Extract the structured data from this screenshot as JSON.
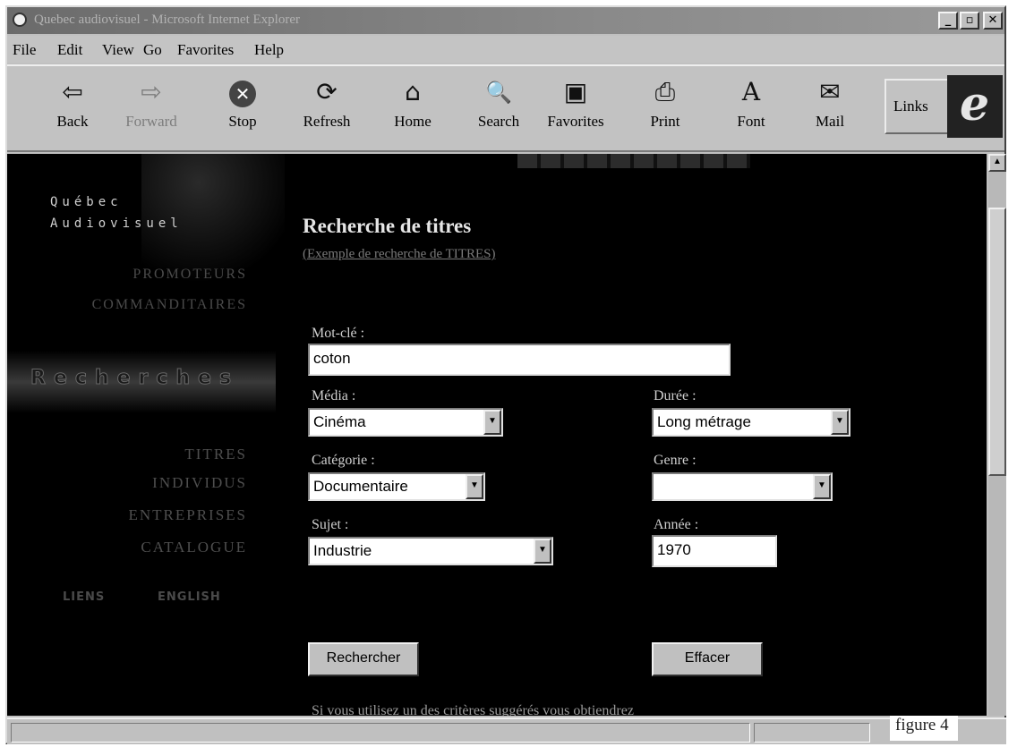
{
  "window": {
    "title": "Quebec audiovisuel - Microsoft Internet Explorer",
    "controls": {
      "minimize": "_",
      "maximize": "▫",
      "close": "✕"
    }
  },
  "menu": [
    "File",
    "Edit",
    "View",
    "Go",
    "Favorites",
    "Help"
  ],
  "toolbar": {
    "buttons": [
      {
        "label": "Back",
        "icon": "back-arrow-icon",
        "glyph": "⇦",
        "enabled": true
      },
      {
        "label": "Forward",
        "icon": "forward-arrow-icon",
        "glyph": "⇨",
        "enabled": false
      },
      {
        "label": "Stop",
        "icon": "stop-icon",
        "glyph": "✕",
        "enabled": true
      },
      {
        "label": "Refresh",
        "icon": "refresh-icon",
        "glyph": "⟳",
        "enabled": true
      },
      {
        "label": "Home",
        "icon": "home-icon",
        "glyph": "⌂",
        "enabled": true
      },
      {
        "label": "Search",
        "icon": "search-icon",
        "glyph": "🔍",
        "enabled": true
      },
      {
        "label": "Favorites",
        "icon": "favorites-icon",
        "glyph": "▣",
        "enabled": true
      },
      {
        "label": "Print",
        "icon": "print-icon",
        "glyph": "⎙",
        "enabled": true
      },
      {
        "label": "Font",
        "icon": "font-icon",
        "glyph": "A",
        "enabled": true
      },
      {
        "label": "Mail",
        "icon": "mail-icon",
        "glyph": "✉",
        "enabled": true
      }
    ],
    "links_label": "Links",
    "logo_glyph": "e"
  },
  "site": {
    "logo_line1": "Québec",
    "logo_line2": "Audiovisuel",
    "nav_top": [
      "PROMOTEURS",
      "COMMANDITAIRES"
    ],
    "section": "Recherches",
    "nav_sub": [
      "TITRES",
      "INDIVIDUS",
      "ENTREPRISES",
      "CATALOGUE"
    ],
    "nav_bottom": [
      "LIENS",
      "ENGLISH"
    ]
  },
  "form": {
    "title": "Recherche de titres",
    "example_link": "(Exemple de recherche de TITRES)",
    "motcle": {
      "label": "Mot-clé :",
      "value": "coton"
    },
    "media": {
      "label": "Média :",
      "value": "Cinéma"
    },
    "duree": {
      "label": "Durée :",
      "value": "Long métrage"
    },
    "categorie": {
      "label": "Catégorie :",
      "value": "Documentaire"
    },
    "genre": {
      "label": "Genre :",
      "value": ""
    },
    "sujet": {
      "label": "Sujet :",
      "value": "Industrie"
    },
    "annee": {
      "label": "Année :",
      "value": "1970"
    },
    "search_button": "Rechercher",
    "clear_button": "Effacer",
    "footer_text": "Si vous utilisez un des critères suggérés vous obtiendrez"
  },
  "caption": "figure 4"
}
